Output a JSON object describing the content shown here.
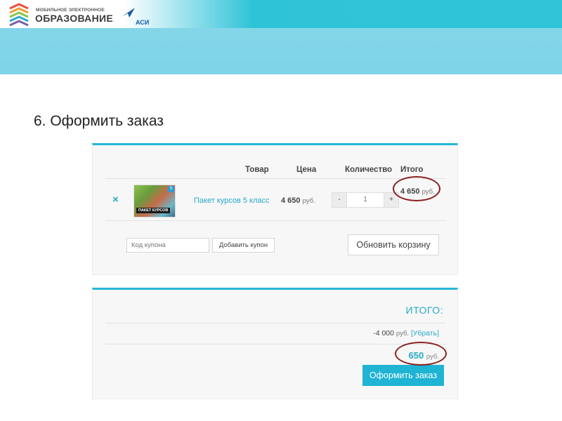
{
  "header": {
    "logo_line1": "МОБИЛЬНОЕ ЭЛЕКТРОННОЕ",
    "logo_line2": "ОБРАЗОВАНИЕ",
    "logo_badge": "АСИ"
  },
  "step_title": "6. Оформить заказ",
  "cart": {
    "columns": [
      "Товар",
      "Цена",
      "Количество",
      "Итого"
    ],
    "item": {
      "thumb_label": "ПАКЕТ КУРСОВ",
      "thumb_badge": "5",
      "name": "Пакет курсов 5 класс",
      "price": "4 650",
      "currency": "руб.",
      "qty_minus": "-",
      "quantity": "1",
      "qty_plus": "+",
      "total": "4 650"
    },
    "remove_icon": "×",
    "coupon_placeholder": "Код купона",
    "coupon_button": "Добавить купон",
    "update_button": "Обновить корзину"
  },
  "totals": {
    "heading": "ИТОГО:",
    "discount_value": "-4 000",
    "currency": "руб.",
    "remove_coupon": "[Убрать]",
    "final_value": "650",
    "checkout_button": "Оформить заказ"
  },
  "colors": {
    "accent": "#25b8d6",
    "annotation": "#8b1e1e"
  }
}
